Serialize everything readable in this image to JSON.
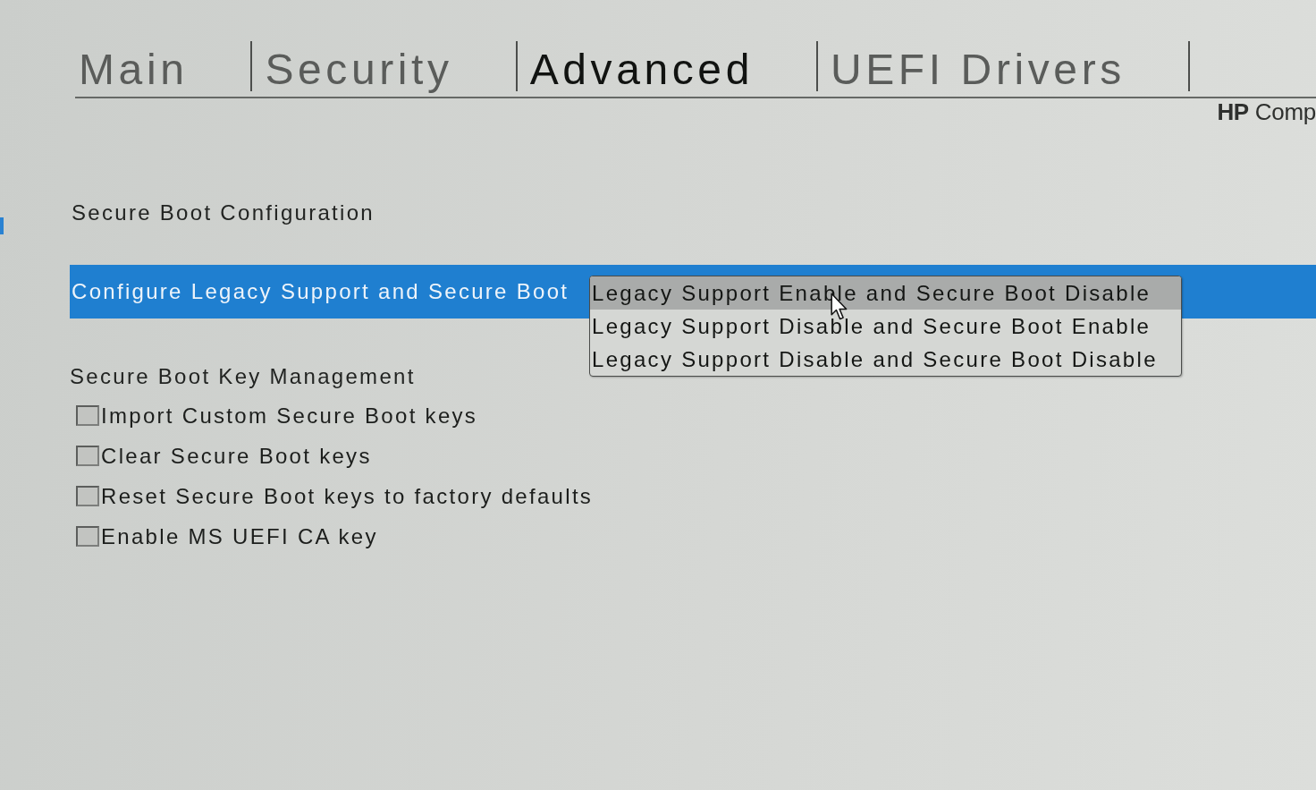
{
  "tabs": [
    {
      "label": "Main",
      "selected": false
    },
    {
      "label": "Security",
      "selected": false
    },
    {
      "label": "Advanced",
      "selected": true
    },
    {
      "label": "UEFI Drivers",
      "selected": false
    }
  ],
  "brand": "**HP** Comp",
  "secure_boot_configuration": {
    "heading": "Secure Boot Configuration",
    "setting": {
      "label": "Configure Legacy Support and Secure Boot",
      "selected": true,
      "dropdown": {
        "expanded": true,
        "options": [
          {
            "label": "Legacy Support Enable and Secure Boot Disable",
            "selected": true
          },
          {
            "label": "Legacy Support Disable and Secure Boot Enable",
            "selected": false
          },
          {
            "label": "Legacy Support Disable and Secure Boot Disable",
            "selected": false
          }
        ]
      }
    }
  },
  "key_management": {
    "heading": "Secure Boot Key Management",
    "options": [
      {
        "label": "Import Custom Secure Boot keys",
        "checked": false
      },
      {
        "label": "Clear Secure Boot keys",
        "checked": false
      },
      {
        "label": "Reset Secure Boot keys to factory defaults",
        "checked": false
      },
      {
        "label": "Enable MS UEFI CA key",
        "checked": false
      }
    ]
  }
}
